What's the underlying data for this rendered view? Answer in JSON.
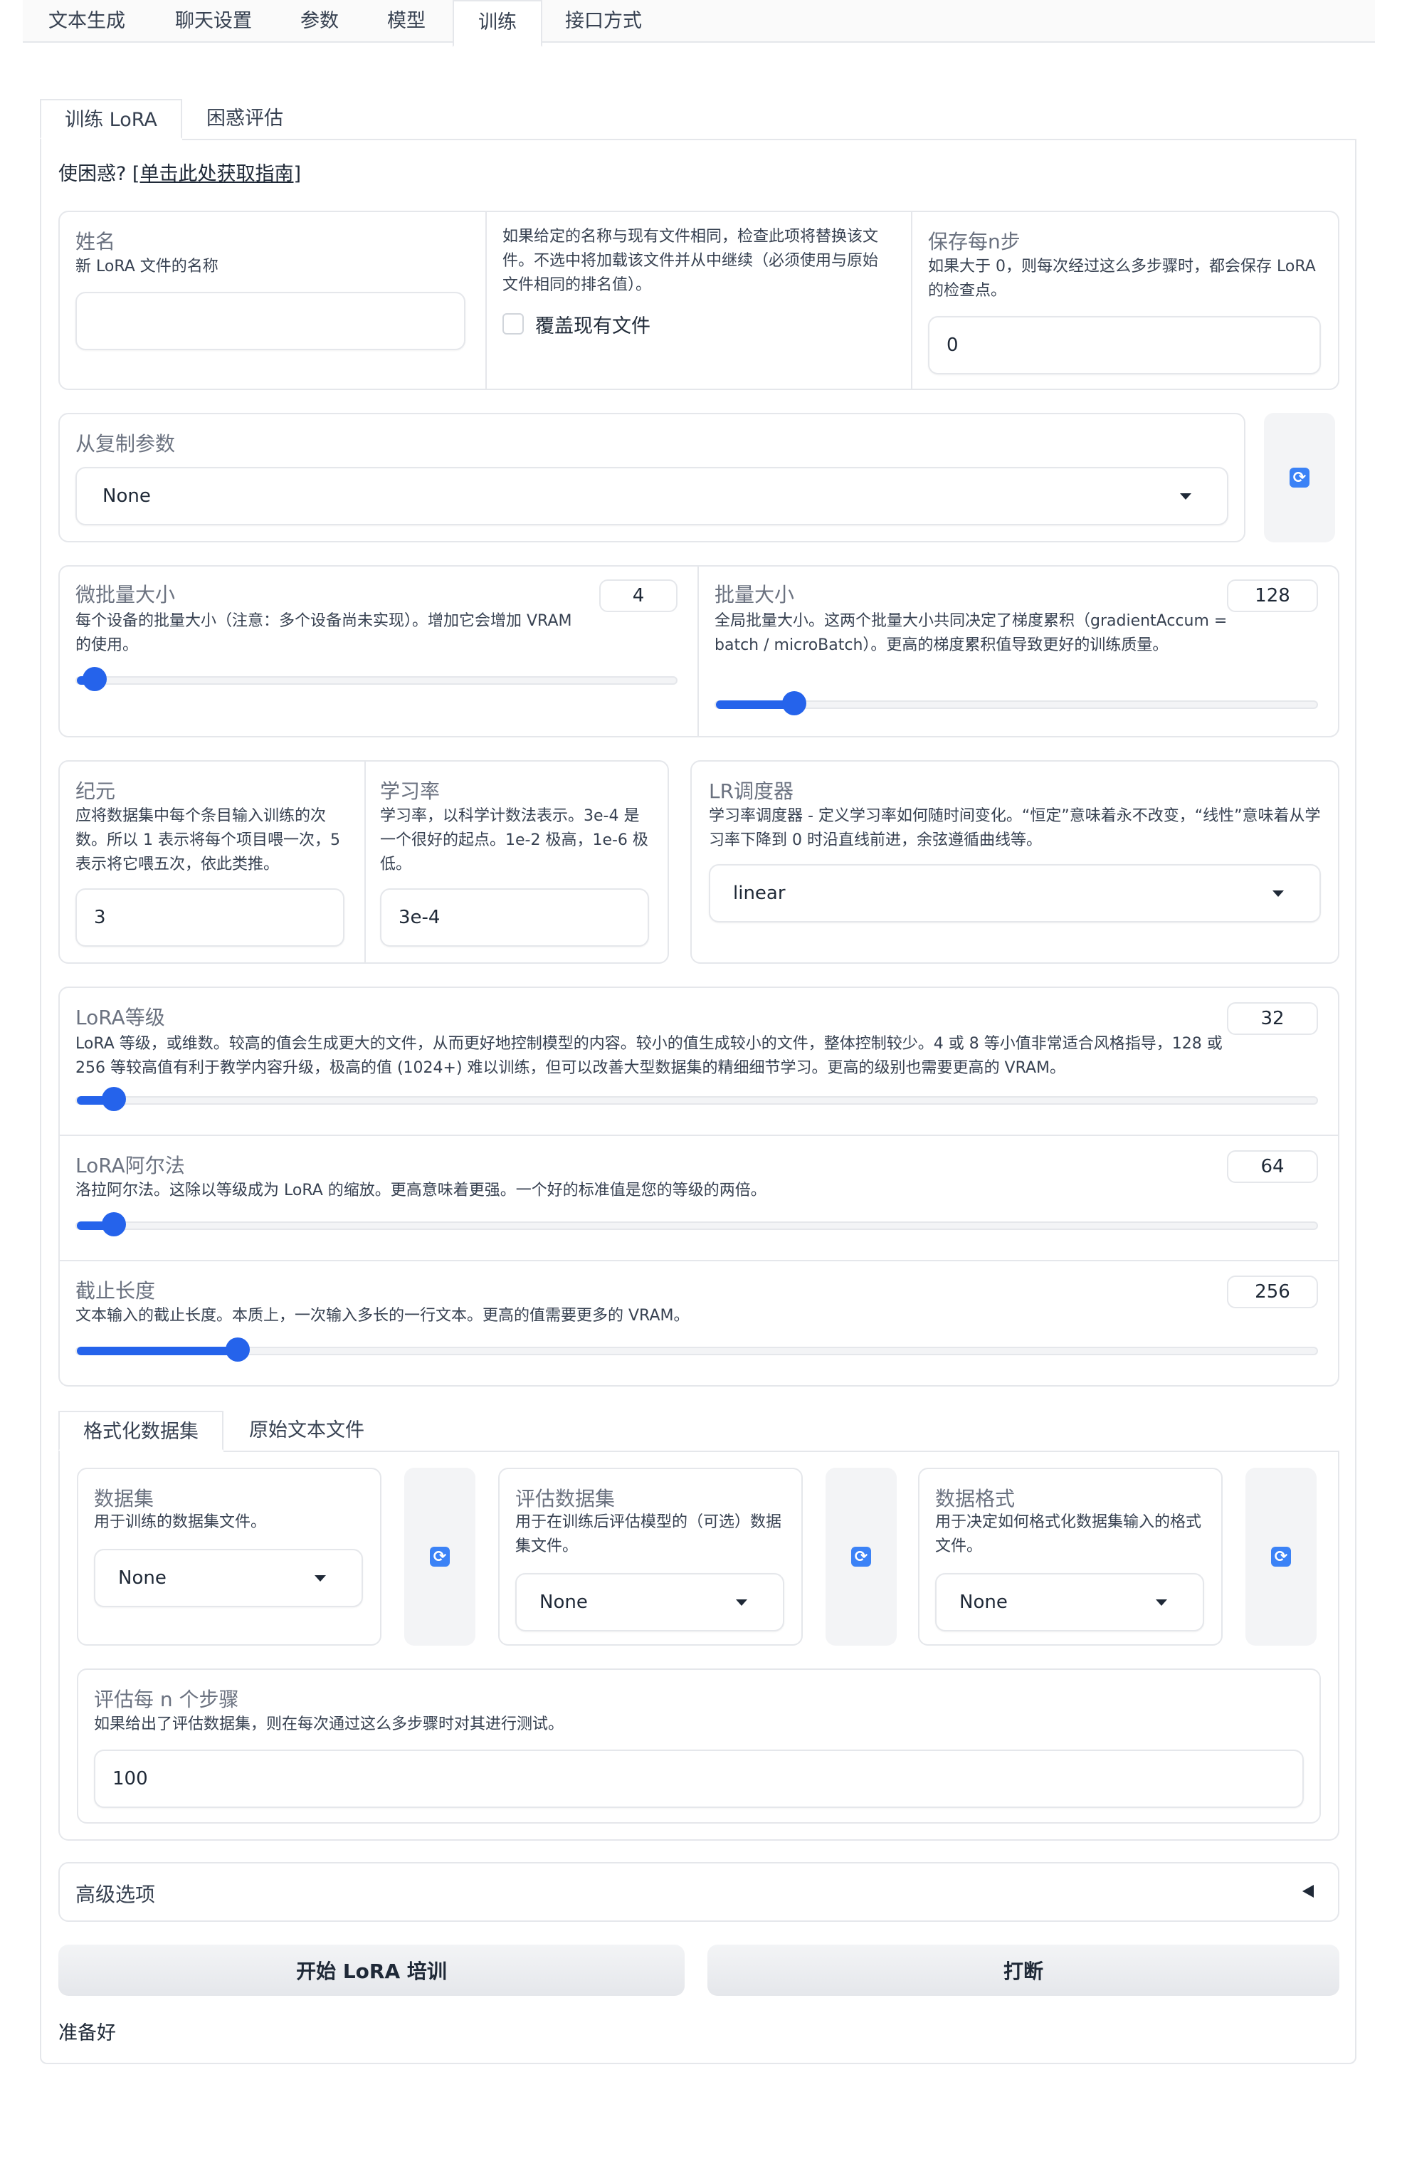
{
  "top_tabs": [
    "文本生成",
    "聊天设置",
    "参数",
    "模型",
    "训练",
    "接口方式"
  ],
  "sub_tabs": [
    "训练 LoRA",
    "困惑评估"
  ],
  "guide": {
    "prefix": "使困惑? ",
    "link": "[单击此处获取指南]"
  },
  "name": {
    "label": "姓名",
    "desc": "新 LoRA 文件的名称",
    "value": ""
  },
  "overwrite": {
    "desc": "如果给定的名称与现有文件相同，检查此项将替换该文件。不选中将加载该文件并从中继续（必须使用与原始文件相同的排名值）。",
    "label": "覆盖现有文件"
  },
  "save_steps": {
    "label": "保存每n步",
    "desc": "如果大于 0，则每次经过这么多步骤时，都会保存 LoRA 的检查点。",
    "value": "0"
  },
  "copy_params": {
    "label": "从复制参数",
    "value": "None"
  },
  "micro_batch": {
    "label": "微批量大小",
    "desc": "每个设备的批量大小（注意：多个设备尚未实现）。增加它会增加 VRAM 的使用。",
    "value": "4",
    "fraction": 0.03
  },
  "batch_size": {
    "label": "批量大小",
    "desc": "全局批量大小。这两个批量大小共同决定了梯度累积（gradientAccum = batch / microBatch）。更高的梯度累积值导致更好的训练质量。",
    "value": "128",
    "fraction": 0.13
  },
  "epochs": {
    "label": "纪元",
    "desc": "应将数据集中每个条目输入训练的次数。所以 1 表示将每个项目喂一次，5 表示将它喂五次，依此类推。",
    "value": "3"
  },
  "learning_rate": {
    "label": "学习率",
    "desc": "学习率，以科学计数法表示。3e-4 是一个很好的起点。1e-2 极高，1e-6 极低。",
    "value": "3e-4"
  },
  "lr_scheduler": {
    "label": "LR调度器",
    "desc": "学习率调度器 - 定义学习率如何随时间变化。“恒定”意味着永不改变，“线性”意味着从学习率下降到 0 时沿直线前进，余弦遵循曲线等。",
    "value": "linear"
  },
  "lora_rank": {
    "label": "LoRA等级",
    "desc": "LoRA 等级，或维数。较高的值会生成更大的文件，从而更好地控制模型的内容。较小的值生成较小的文件，整体控制较少。4 或 8 等小值非常适合风格指导，128 或 256 等较高值有利于教学内容升级，极高的值 (1024+) 难以训练，但可以改善大型数据集的精细细节学习。更高的级别也需要更高的 VRAM。",
    "value": "32",
    "fraction": 0.03
  },
  "lora_alpha": {
    "label": "LoRA阿尔法",
    "desc": "洛拉阿尔法。这除以等级成为 LoRA 的缩放。更高意味着更强。一个好的标准值是您的等级的两倍。",
    "value": "64",
    "fraction": 0.03
  },
  "cutoff_len": {
    "label": "截止长度",
    "desc": "文本输入的截止长度。本质上，一次输入多长的一行文本。更高的值需要更多的 VRAM。",
    "value": "256",
    "fraction": 0.13
  },
  "dataset_tabs": [
    "格式化数据集",
    "原始文本文件"
  ],
  "dataset": {
    "label": "数据集",
    "desc": "用于训练的数据集文件。",
    "value": "None"
  },
  "eval_dataset": {
    "label": "评估数据集",
    "desc": "用于在训练后评估模型的（可选）数据集文件。",
    "value": "None"
  },
  "data_format": {
    "label": "数据格式",
    "desc": "用于决定如何格式化数据集输入的格式文件。",
    "value": "None"
  },
  "eval_steps": {
    "label": "评估每 n 个步骤",
    "desc": "如果给出了评估数据集，则在每次通过这么多步骤时对其进行测试。",
    "value": "100"
  },
  "advanced": {
    "label": "高级选项"
  },
  "buttons": {
    "start": "开始 LoRA 培训",
    "interrupt": "打断"
  },
  "status": "准备好",
  "icons": {
    "refresh": "refresh-icon",
    "caret": "chevron-down-icon",
    "collapse": "triangle-left-icon"
  },
  "colors": {
    "accent": "#2563eb",
    "border": "#e5e7eb"
  }
}
